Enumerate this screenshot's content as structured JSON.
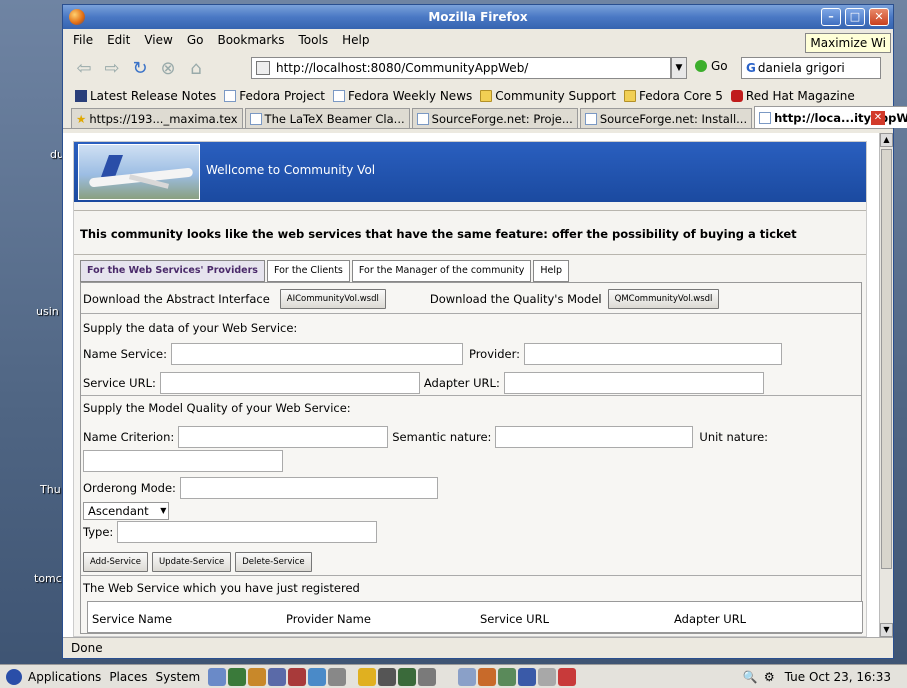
{
  "desktop": {
    "labels": [
      "du",
      "usin",
      "Thu",
      "tomc"
    ]
  },
  "window": {
    "title": "Mozilla Firefox",
    "controls": {
      "minimize": "–",
      "maximize": "□",
      "close": "✕"
    }
  },
  "menubar": {
    "items": [
      "File",
      "Edit",
      "View",
      "Go",
      "Bookmarks",
      "Tools",
      "Help"
    ],
    "tooltip": "Maximize Wi"
  },
  "navbar": {
    "url": "http://localhost:8080/CommunityAppWeb/",
    "go_label": "Go",
    "search_value": "daniela grigori",
    "search_engine": "G"
  },
  "bookmarks": [
    {
      "label": "Latest Release Notes",
      "icon": "fedora-icon"
    },
    {
      "label": "Fedora Project",
      "icon": "page-icon"
    },
    {
      "label": "Fedora Weekly News",
      "icon": "page-icon"
    },
    {
      "label": "Community Support",
      "icon": "folder-icon"
    },
    {
      "label": "Fedora Core 5",
      "icon": "folder-icon"
    },
    {
      "label": "Red Hat Magazine",
      "icon": "redhat-icon"
    }
  ],
  "tabs": [
    {
      "label": "https://193..._maxima.tex",
      "active": false
    },
    {
      "label": "The LaTeX Beamer Cla...",
      "active": false
    },
    {
      "label": "SourceForge.net: Proje...",
      "active": false
    },
    {
      "label": "SourceForge.net: Install...",
      "active": false
    },
    {
      "label": "http://loca...ityAppWeb/",
      "active": true
    }
  ],
  "page": {
    "welcome": "Wellcome to Community Vol",
    "description": "This community looks like the web services that have the same feature: offer the possibility of buying a ticket",
    "tabs": [
      "For the Web Services' Providers",
      "For the Clients",
      "For the Manager of the community",
      "Help"
    ],
    "download_interface_label": "Download the Abstract Interface",
    "download_interface_btn": "AICommunityVol.wsdl",
    "download_quality_label": "Download the Quality's Model",
    "download_quality_btn": "QMCommunityVol.wsdl",
    "supply_data": "Supply the data of your Web Service:",
    "name_service": "Name Service:",
    "provider": "Provider:",
    "service_url": "Service URL:",
    "adapter_url": "Adapter URL:",
    "supply_model": "Supply the Model Quality of your Web Service:",
    "name_criterion": "Name Criterion:",
    "semantic_nature": "Semantic nature:",
    "unit_nature": "Unit nature:",
    "ordering_mode": "Orderong Mode:",
    "order_value": "Ascendant",
    "type": "Type:",
    "add_btn": "Add-Service",
    "update_btn": "Update-Service",
    "delete_btn": "Delete-Service",
    "registered": "The Web Service which you have just registered",
    "columns": [
      "Service Name",
      "Provider Name",
      "Service URL",
      "Adapter URL"
    ]
  },
  "status": "Done",
  "taskbar": {
    "menus": [
      "Applications",
      "Places",
      "System"
    ],
    "clock": "Tue Oct 23, 16:33"
  }
}
